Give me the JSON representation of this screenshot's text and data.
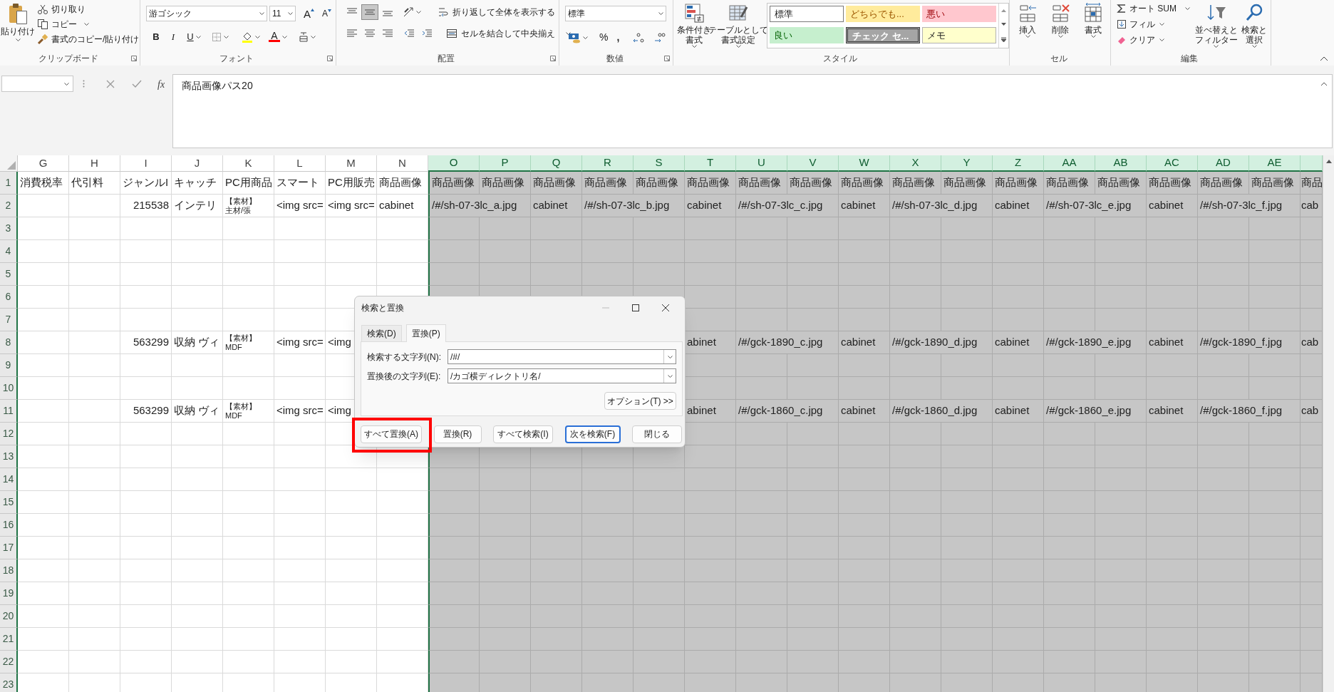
{
  "ribbon": {
    "clipboard": {
      "paste": "貼り付け",
      "cut": "切り取り",
      "copy": "コピー",
      "format_painter": "書式のコピー/貼り付け",
      "label": "クリップボード",
      "launcher": true
    },
    "font": {
      "font_name": "游ゴシック",
      "font_size": "11",
      "grow": "A",
      "shrink": "A",
      "bold": "B",
      "italic": "I",
      "underline": "U",
      "font_color": "A",
      "label": "フォント",
      "launcher": true
    },
    "alignment": {
      "vertical_align": [
        {
          "selected": false
        },
        {
          "selected": true
        },
        {
          "selected": false
        }
      ],
      "wrap_text": "折り返して全体を表示する",
      "merge_center": "セルを結合して中央揃え",
      "label": "配置",
      "launcher": true
    },
    "number": {
      "format": "標準",
      "percent": "%",
      "comma": ",",
      "label": "数値",
      "launcher": true
    },
    "styles": {
      "conditional_format": [
        "条件付き",
        "書式"
      ],
      "format_as_table": [
        "テーブルとして",
        "書式設定"
      ],
      "gallery": [
        {
          "text": "標準",
          "color": "#ffffff"
        },
        {
          "text": "どちらでも...",
          "color": "#ffeb9c"
        },
        {
          "text": "悪い",
          "color": "#ffc7ce"
        },
        {
          "text": "良い",
          "color": "#c6efce"
        },
        {
          "text": "チェック セ...",
          "color": "#a5a5a5"
        },
        {
          "text": "メモ",
          "color": "#ffffcc"
        }
      ],
      "label": "スタイル",
      "launcher": false
    },
    "cells": {
      "insert": "挿入",
      "delete": "削除",
      "format": "書式",
      "label": "セル",
      "launcher": false
    },
    "editing": {
      "autosum": "オート SUM",
      "fill": "フィル",
      "clear": "クリア",
      "sort_filter": [
        "並べ替えと",
        "フィルター"
      ],
      "find_select": [
        "検索と",
        "選択"
      ],
      "label": "編集",
      "launcher": false
    }
  },
  "formula_bar": {
    "function_label": "fx",
    "value": "商品画像パス20"
  },
  "sheet": {
    "columns": [
      {
        "label": "G",
        "selected": false
      },
      {
        "label": "H",
        "selected": false
      },
      {
        "label": "I",
        "selected": false
      },
      {
        "label": "J",
        "selected": false
      },
      {
        "label": "K",
        "selected": false
      },
      {
        "label": "L",
        "selected": false
      },
      {
        "label": "M",
        "selected": false
      },
      {
        "label": "N",
        "selected": false
      },
      {
        "label": "O",
        "selected": true
      },
      {
        "label": "P",
        "selected": true
      },
      {
        "label": "Q",
        "selected": true
      },
      {
        "label": "R",
        "selected": true
      },
      {
        "label": "S",
        "selected": true
      },
      {
        "label": "T",
        "selected": true
      },
      {
        "label": "U",
        "selected": true
      },
      {
        "label": "V",
        "selected": true
      },
      {
        "label": "W",
        "selected": true
      },
      {
        "label": "X",
        "selected": true
      },
      {
        "label": "Y",
        "selected": true
      },
      {
        "label": "Z",
        "selected": true
      },
      {
        "label": "AA",
        "selected": true
      },
      {
        "label": "AB",
        "selected": true
      },
      {
        "label": "AC",
        "selected": true
      },
      {
        "label": "AD",
        "selected": true
      },
      {
        "label": "AE",
        "selected": true
      },
      {
        "selected": true
      }
    ],
    "rows": [
      {
        "number": "1",
        "cells": [
          {
            "kind": "text",
            "text": "消費税率"
          },
          {
            "kind": "text",
            "text": "代引料"
          },
          {
            "kind": "text",
            "text": "ジャンルI"
          },
          {
            "kind": "text",
            "text": "キャッチ"
          },
          {
            "kind": "text",
            "text": "PC用商品"
          },
          {
            "kind": "text",
            "text": "スマート"
          },
          {
            "kind": "text",
            "text": "PC用販売"
          },
          {
            "kind": "text",
            "text": "商品画像"
          },
          {
            "kind": "text",
            "text": "商品画像"
          },
          {
            "kind": "text",
            "text": "商品画像"
          },
          {
            "kind": "text",
            "text": "商品画像"
          },
          {
            "kind": "text",
            "text": "商品画像"
          },
          {
            "kind": "text",
            "text": "商品画像"
          },
          {
            "kind": "text",
            "text": "商品画像"
          },
          {
            "kind": "text",
            "text": "商品画像"
          },
          {
            "kind": "text",
            "text": "商品画像"
          },
          {
            "kind": "text",
            "text": "商品画像"
          },
          {
            "kind": "text",
            "text": "商品画像"
          },
          {
            "kind": "text",
            "text": "商品画像"
          },
          {
            "kind": "text",
            "text": "商品画像"
          },
          {
            "kind": "text",
            "text": "商品画像"
          },
          {
            "kind": "text",
            "text": "商品画像"
          },
          {
            "kind": "text",
            "text": "商品画像"
          },
          {
            "kind": "text",
            "text": "商品画像"
          },
          {
            "kind": "text",
            "text": "商品画像"
          },
          {
            "kind": "text",
            "text": "商品"
          }
        ]
      },
      {
        "number": "2",
        "cells": [
          {},
          {},
          {
            "kind": "number",
            "text": "215538"
          },
          {
            "kind": "text",
            "text": "インテリ"
          },
          {
            "kind": "wrapped",
            "lines": [
              "【素材】",
              "主材/張"
            ]
          },
          {
            "kind": "text",
            "text": "<img src="
          },
          {
            "kind": "text",
            "text": "<img src="
          },
          {
            "kind": "text",
            "text": "cabinet"
          },
          {
            "kind": "text",
            "text": "/#/sh-07-3lc_a.jpg"
          },
          {},
          {
            "kind": "text",
            "text": "cabinet"
          },
          {
            "kind": "text",
            "text": "/#/sh-07-3lc_b.jpg"
          },
          {},
          {
            "kind": "text",
            "text": "cabinet"
          },
          {
            "kind": "text",
            "text": "/#/sh-07-3lc_c.jpg"
          },
          {},
          {
            "kind": "text",
            "text": "cabinet"
          },
          {
            "kind": "text",
            "text": "/#/sh-07-3lc_d.jpg"
          },
          {},
          {
            "kind": "text",
            "text": "cabinet"
          },
          {
            "kind": "text",
            "text": "/#/sh-07-3lc_e.jpg"
          },
          {},
          {
            "kind": "text",
            "text": "cabinet"
          },
          {
            "kind": "text",
            "text": "/#/sh-07-3lc_f.jpg"
          },
          {},
          {
            "kind": "text",
            "text": "cab"
          }
        ]
      },
      {
        "number": "3"
      },
      {
        "number": "4"
      },
      {
        "number": "5"
      },
      {
        "number": "6"
      },
      {
        "number": "7"
      },
      {
        "number": "8",
        "cells": [
          {},
          {},
          {
            "kind": "number",
            "text": "563299"
          },
          {
            "kind": "text",
            "text": "収納 ヴィ"
          },
          {
            "kind": "wrapped",
            "lines": [
              "【素材】",
              "MDF"
            ]
          },
          {
            "kind": "text",
            "text": "<img src="
          },
          {
            "kind": "text",
            "text": "<img"
          },
          {},
          {},
          {},
          {},
          {},
          {},
          {
            "kind": "text",
            "text": "abinet"
          },
          {
            "kind": "text",
            "text": "/#/gck-1890_c.jpg"
          },
          {},
          {
            "kind": "text",
            "text": "cabinet"
          },
          {
            "kind": "text",
            "text": "/#/gck-1890_d.jpg"
          },
          {},
          {
            "kind": "text",
            "text": "cabinet"
          },
          {
            "kind": "text",
            "text": "/#/gck-1890_e.jpg"
          },
          {},
          {
            "kind": "text",
            "text": "cabinet"
          },
          {
            "kind": "text",
            "text": "/#/gck-1890_f.jpg"
          },
          {},
          {
            "kind": "text",
            "text": "cab"
          }
        ]
      },
      {
        "number": "9"
      },
      {
        "number": "10"
      },
      {
        "number": "11",
        "cells": [
          {},
          {},
          {
            "kind": "number",
            "text": "563299"
          },
          {
            "kind": "text",
            "text": "収納 ヴィ"
          },
          {
            "kind": "wrapped",
            "lines": [
              "【素材】",
              "MDF"
            ]
          },
          {
            "kind": "text",
            "text": "<img src="
          },
          {
            "kind": "text",
            "text": "<img"
          },
          {},
          {},
          {},
          {},
          {},
          {},
          {
            "kind": "text",
            "text": "abinet"
          },
          {
            "kind": "text",
            "text": "/#/gck-1860_c.jpg"
          },
          {},
          {
            "kind": "text",
            "text": "cabinet"
          },
          {
            "kind": "text",
            "text": "/#/gck-1860_d.jpg"
          },
          {},
          {
            "kind": "text",
            "text": "cabinet"
          },
          {
            "kind": "text",
            "text": "/#/gck-1860_e.jpg"
          },
          {},
          {
            "kind": "text",
            "text": "cabinet"
          },
          {
            "kind": "text",
            "text": "/#/gck-1860_f.jpg"
          },
          {},
          {
            "kind": "text",
            "text": "cab"
          }
        ]
      },
      {
        "number": "12"
      },
      {
        "number": "13"
      },
      {
        "number": "14"
      },
      {
        "number": "15"
      },
      {
        "number": "16"
      },
      {
        "number": "17"
      },
      {
        "number": "18"
      },
      {
        "number": "19"
      },
      {
        "number": "20"
      },
      {
        "number": "21"
      },
      {
        "number": "22"
      },
      {
        "number": "23"
      }
    ]
  },
  "dialog": {
    "title": "検索と置換",
    "tabs": [
      {
        "label": "検索(D)",
        "selected": false
      },
      {
        "label": "置換(P)",
        "selected": true
      }
    ],
    "fields": [
      {
        "label": "検索する文字列(N):",
        "value": "/#/"
      },
      {
        "label": "置換後の文字列(E):",
        "value": "/カゴ横ディレクトリ名/"
      }
    ],
    "options_button": "オプション(T) >>",
    "buttons": [
      {
        "label": "すべて置換(A)",
        "highlighted": true,
        "default": false
      },
      {
        "label": "置換(R)",
        "highlighted": false,
        "default": false
      },
      {
        "label": "すべて検索(I)",
        "highlighted": false,
        "default": false
      },
      {
        "label": "次を検索(F)",
        "highlighted": false,
        "default": true
      },
      {
        "label": "閉じる",
        "highlighted": false,
        "default": false
      }
    ]
  }
}
